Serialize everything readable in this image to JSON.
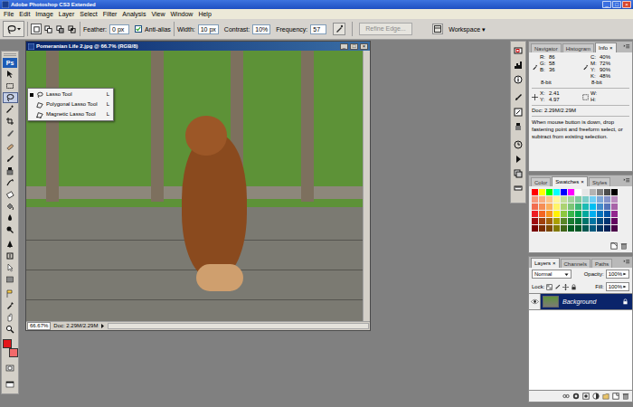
{
  "window": {
    "title": "Adobe Photoshop CS3 Extended",
    "controls": [
      "_",
      "□",
      "×"
    ]
  },
  "menu": [
    "File",
    "Edit",
    "Image",
    "Layer",
    "Select",
    "Filter",
    "Analysis",
    "View",
    "Window",
    "Help"
  ],
  "options_bar": {
    "selection_modes": [
      {
        "selected": true
      },
      {
        "selected": false
      },
      {
        "selected": false
      },
      {
        "selected": false
      }
    ],
    "feather_label": "Feather:",
    "feather": "0 px",
    "anti_alias": {
      "label": "Anti-alias",
      "checked": true
    },
    "width_label": "Width:",
    "width": "10 px",
    "contrast_label": "Contrast:",
    "contrast": "10%",
    "frequency_label": "Frequency:",
    "frequency": "57",
    "refine_edge": {
      "label": "Refine Edge...",
      "disabled": true
    },
    "workspace": "Workspace ▾"
  },
  "toolbox": {
    "logo": "Ps",
    "tools": [
      {
        "selected": false
      },
      {
        "selected": false
      },
      {
        "selected": true
      },
      {
        "selected": false
      },
      {
        "selected": false
      },
      {
        "selected": false
      },
      {
        "selected": false
      },
      {
        "selected": false
      },
      {
        "selected": false
      },
      {
        "selected": false
      },
      {
        "selected": false
      },
      {
        "selected": false
      },
      {
        "selected": false
      },
      {
        "selected": false
      },
      {
        "selected": false
      },
      {
        "selected": false
      },
      {
        "selected": false
      },
      {
        "selected": false
      },
      {
        "selected": false
      },
      {
        "selected": false
      },
      {
        "selected": false
      },
      {
        "selected": false
      }
    ],
    "foreground_color": "#e3161b",
    "background_color": "#f26a6a"
  },
  "document": {
    "title": "Pomeranian Life 2.jpg @ 66.7% (RGB/8)",
    "controls": [
      "_",
      "□",
      "×"
    ],
    "zoom": "66.67%",
    "info": "Doc: 2.29M/2.29M"
  },
  "flyout": [
    {
      "label": "Lasso Tool",
      "shortcut": "L",
      "selected": true
    },
    {
      "label": "Polygonal Lasso Tool",
      "shortcut": "L",
      "selected": false
    },
    {
      "label": "Magnetic Lasso Tool",
      "shortcut": "L",
      "selected": false
    }
  ],
  "navigator_panel": {
    "tabs": [
      {
        "label": "Navigator",
        "selected": false
      },
      {
        "label": "Histogram",
        "selected": false
      },
      {
        "label": "Info",
        "selected": true,
        "close": "×"
      }
    ],
    "color_left": [
      {
        "label": "R:",
        "value": "86"
      },
      {
        "label": "G:",
        "value": "58"
      },
      {
        "label": "B:",
        "value": "36"
      }
    ],
    "color_right": [
      {
        "label": "C:",
        "value": "40%"
      },
      {
        "label": "M:",
        "value": "72%"
      },
      {
        "label": "Y:",
        "value": "90%"
      },
      {
        "label": "K:",
        "value": "48%"
      }
    ],
    "bits": [
      "8-bit",
      "8-bit"
    ],
    "pos_left": [
      {
        "label": "X:",
        "value": "2.41"
      },
      {
        "label": "Y:",
        "value": "4.97"
      }
    ],
    "pos_right": [
      {
        "label": "W:"
      },
      {
        "label": "H:"
      }
    ],
    "doc": "Doc: 2.29M/2.29M",
    "hint": "When mouse button is down, drop fastening point and freeform select, or subtract from existing selection."
  },
  "swatches_panel": {
    "tabs": [
      {
        "label": "Color",
        "selected": false
      },
      {
        "label": "Swatches",
        "selected": true,
        "close": "×"
      },
      {
        "label": "Styles",
        "selected": false
      }
    ],
    "swatches": [
      {
        "color": "#ff0000"
      },
      {
        "color": "#ffff00"
      },
      {
        "color": "#00ff00"
      },
      {
        "color": "#00ffff"
      },
      {
        "color": "#0000ff"
      },
      {
        "color": "#ff00ff"
      },
      {
        "color": "#ffffff"
      },
      {
        "color": "#e6e6e6"
      },
      {
        "color": "#b3b3b3"
      },
      {
        "color": "#808080"
      },
      {
        "color": "#4d4d4d"
      },
      {
        "color": "#000000"
      },
      {
        "color": "#f7977a"
      },
      {
        "color": "#f9ad81"
      },
      {
        "color": "#fdc68a"
      },
      {
        "color": "#fff79a"
      },
      {
        "color": "#c4df9b"
      },
      {
        "color": "#a2d39c"
      },
      {
        "color": "#82ca9d"
      },
      {
        "color": "#7bcdc8"
      },
      {
        "color": "#6ecff6"
      },
      {
        "color": "#7ea7d8"
      },
      {
        "color": "#8493ca"
      },
      {
        "color": "#bc8dbf"
      },
      {
        "color": "#f26c4f"
      },
      {
        "color": "#f68e55"
      },
      {
        "color": "#fbaf5c"
      },
      {
        "color": "#fff467"
      },
      {
        "color": "#acd372"
      },
      {
        "color": "#7cc576"
      },
      {
        "color": "#3bb878"
      },
      {
        "color": "#1abbb4"
      },
      {
        "color": "#00bff3"
      },
      {
        "color": "#438ccb"
      },
      {
        "color": "#5574b9"
      },
      {
        "color": "#a864a8"
      },
      {
        "color": "#ed1c24"
      },
      {
        "color": "#f26522"
      },
      {
        "color": "#f7941d"
      },
      {
        "color": "#fff200"
      },
      {
        "color": "#8dc73f"
      },
      {
        "color": "#39b54a"
      },
      {
        "color": "#00a651"
      },
      {
        "color": "#00a99d"
      },
      {
        "color": "#00aeef"
      },
      {
        "color": "#0072bc"
      },
      {
        "color": "#0054a6"
      },
      {
        "color": "#92278f"
      },
      {
        "color": "#9e0b0f"
      },
      {
        "color": "#a0410d"
      },
      {
        "color": "#a36209"
      },
      {
        "color": "#aba000"
      },
      {
        "color": "#598527"
      },
      {
        "color": "#1a7b30"
      },
      {
        "color": "#007236"
      },
      {
        "color": "#00746b"
      },
      {
        "color": "#0076a3"
      },
      {
        "color": "#004b80"
      },
      {
        "color": "#003471"
      },
      {
        "color": "#630460"
      },
      {
        "color": "#790000"
      },
      {
        "color": "#7b2e00"
      },
      {
        "color": "#7d4900"
      },
      {
        "color": "#827b00"
      },
      {
        "color": "#406618"
      },
      {
        "color": "#005e20"
      },
      {
        "color": "#005826"
      },
      {
        "color": "#005952"
      },
      {
        "color": "#005b7f"
      },
      {
        "color": "#003663"
      },
      {
        "color": "#002157"
      },
      {
        "color": "#4b0049"
      }
    ]
  },
  "layers_panel": {
    "tabs": [
      {
        "label": "Layers",
        "selected": true,
        "close": "×"
      },
      {
        "label": "Channels",
        "selected": false
      },
      {
        "label": "Paths",
        "selected": false
      }
    ],
    "blend_mode": "Normal",
    "opacity_label": "Opacity:",
    "opacity": "100%",
    "lock_label": "Lock:",
    "fill_label": "Fill:",
    "fill": "100%",
    "layers": [
      {
        "name": "Background",
        "selected": true,
        "visible": true,
        "locked": true
      }
    ]
  }
}
